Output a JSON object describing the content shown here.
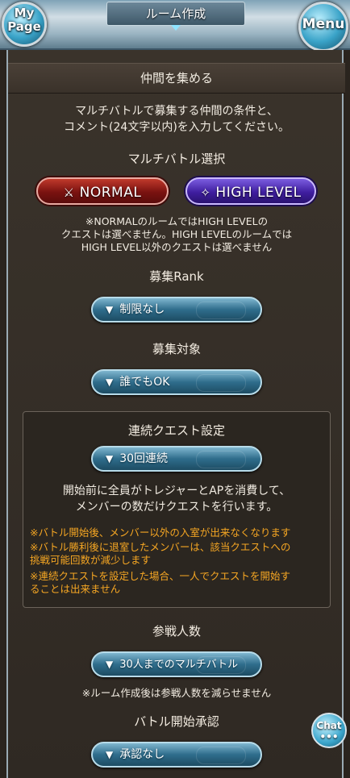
{
  "header": {
    "title": "ルーム作成",
    "mypage_line1": "My",
    "mypage_line2": "Page",
    "menu_label": "Menu"
  },
  "main": {
    "section_title": "仲間を集める",
    "intro_line1": "マルチバトルで募集する仲間の条件と、",
    "intro_line2": "コメント(24文字以内)を入力してください。",
    "battle_select_title": "マルチバトル選択",
    "normal_label": "NORMAL",
    "high_label": "HIGH LEVEL",
    "mode_note_line1": "※NORMALのルームではHIGH LEVELの",
    "mode_note_line2": "クエストは選べません。HIGH LEVELのルームでは",
    "mode_note_line3": "HIGH LEVEL以外のクエストは選べません",
    "rank_title": "募集Rank",
    "rank_value": "制限なし",
    "target_title": "募集対象",
    "target_value": "誰でもOK",
    "continuous": {
      "title": "連続クエスト設定",
      "value": "30回連続",
      "desc_line1": "開始前に全員がトレジャーとAPを消費して、",
      "desc_line2": "メンバーの数だけクエストを行います。",
      "warn1": "※バトル開始後、メンバー以外の入室が出来なくなります",
      "warn2_line1": "※バトル勝利後に退室したメンバーは、該当クエストへの",
      "warn2_line2": "挑戦可能回数が減少します",
      "warn3_line1": "※連続クエストを設定した場合、一人でクエストを開始す",
      "warn3_line2": "ることは出来ません"
    },
    "participants_title": "参戦人数",
    "participants_value": "30人までのマルチバトル",
    "participants_note": "※ルーム作成後は参戦人数を減らせません",
    "approval_title": "バトル開始承認",
    "approval_value": "承認なし"
  },
  "chat": {
    "line1": "Chat",
    "line2": "•••"
  },
  "colors": {
    "warning": "#f5a623",
    "normal_button": "#7a1210",
    "high_button": "#3f1ea0",
    "dropdown": "#2f6d8c"
  },
  "icons": [
    "mypage-orb-icon",
    "menu-orb-icon",
    "crossed-swords-icon",
    "high-level-emblem-icon",
    "dropdown-arrow-icon",
    "chat-bubble-icon"
  ]
}
